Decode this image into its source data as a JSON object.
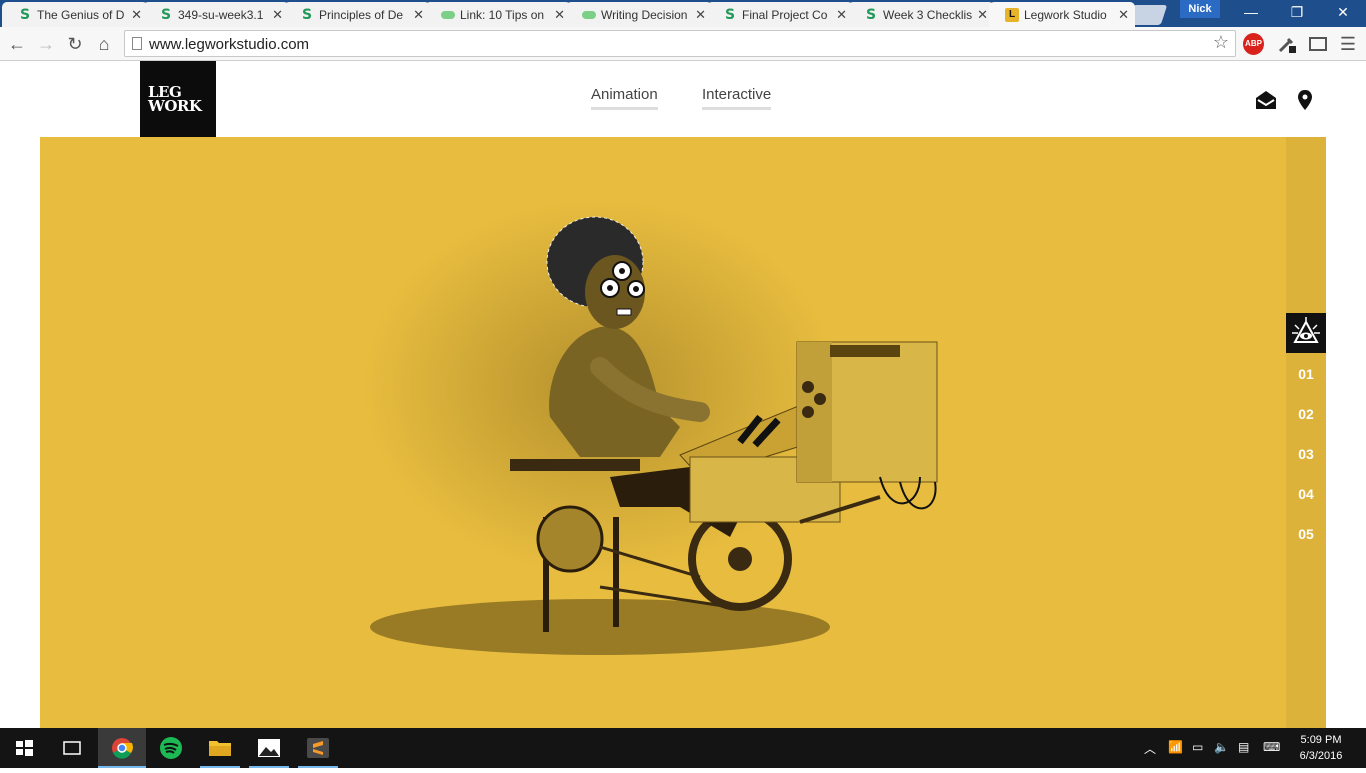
{
  "browser": {
    "tabs": [
      {
        "title": "The Genius of D",
        "favicon": "s"
      },
      {
        "title": "349-su-week3.1",
        "favicon": "s"
      },
      {
        "title": "Principles of De",
        "favicon": "s"
      },
      {
        "title": "Link: 10 Tips on",
        "favicon": "cloud"
      },
      {
        "title": "Writing Decision",
        "favicon": "cloud"
      },
      {
        "title": "Final Project Co",
        "favicon": "s"
      },
      {
        "title": "Week 3 Checklis",
        "favicon": "s"
      },
      {
        "title": "Legwork Studio",
        "favicon": "l",
        "active": true
      }
    ],
    "user": "Nick",
    "url": "www.legworkstudio.com",
    "abp_label": "ABP"
  },
  "site": {
    "logo_line1": "LEG",
    "logo_line2": "WORK",
    "nav": [
      {
        "label": "Animation"
      },
      {
        "label": "Interactive"
      }
    ],
    "rail_numbers": [
      "01",
      "02",
      "03",
      "04",
      "05"
    ],
    "colors": {
      "hero": "#e8bd3f",
      "rail": "#dcb23a"
    }
  },
  "taskbar": {
    "time": "5:09 PM",
    "date": "6/3/2016"
  }
}
